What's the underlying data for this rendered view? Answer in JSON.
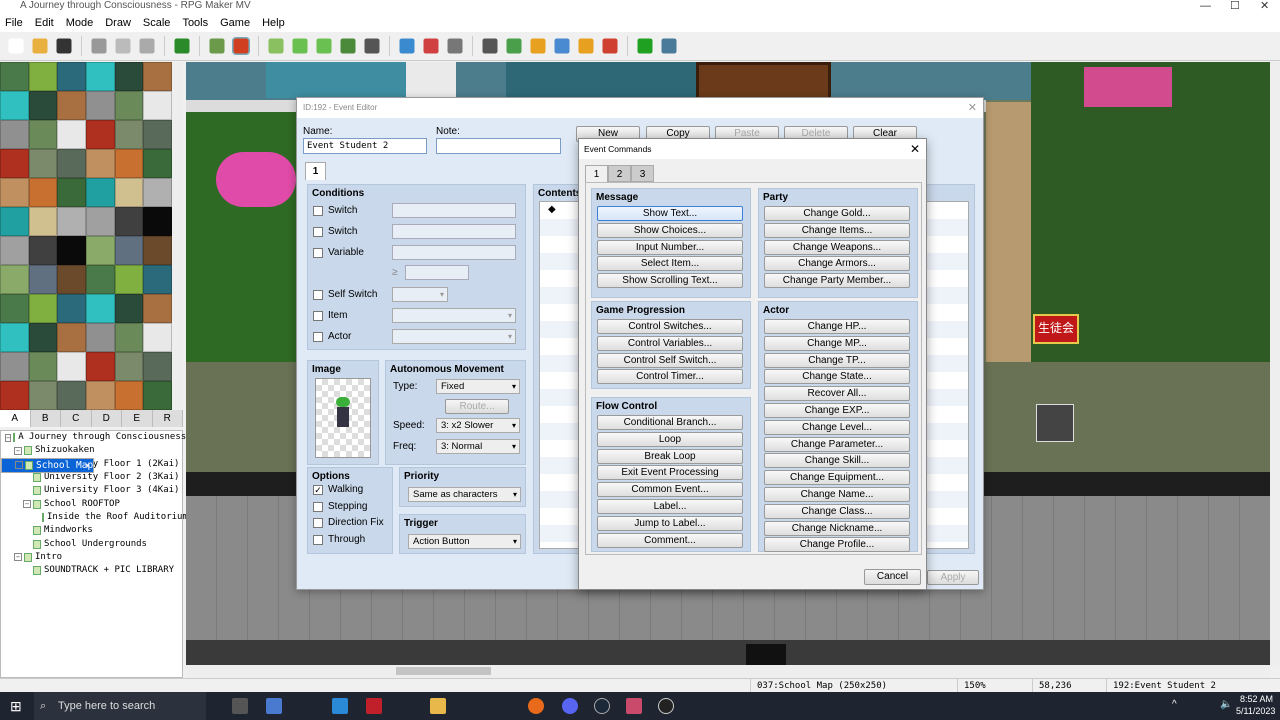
{
  "window": {
    "title": "A Journey through Consciousness - RPG Maker MV"
  },
  "menu": [
    "File",
    "Edit",
    "Mode",
    "Draw",
    "Scale",
    "Tools",
    "Game",
    "Help"
  ],
  "toolbar": [
    "new-icon",
    "open-icon",
    "save-icon",
    "cut-icon",
    "copy-icon",
    "paste-icon",
    "undo-icon",
    "map-mode-icon",
    "event-mode-icon",
    "pencil-icon",
    "rectangle-icon",
    "ellipse-icon",
    "fill-icon",
    "shadow-pen-icon",
    "zoom-in-icon",
    "zoom-out-icon",
    "actual-size-icon",
    "database-icon",
    "plugin-manager-icon",
    "sound-test-icon",
    "event-searcher-icon",
    "resource-manager-icon",
    "character-generator-icon",
    "playtest-icon",
    "deployment-icon"
  ],
  "tileset_tabs": [
    "A",
    "B",
    "C",
    "D",
    "E",
    "R"
  ],
  "map_tree": [
    {
      "label": "A Journey through Consciousness",
      "level": 0,
      "expander": true
    },
    {
      "label": "Shizuokaken",
      "level": 1,
      "expander": true
    },
    {
      "label": "School Map",
      "level": 1,
      "expander": true,
      "selected": true
    },
    {
      "label": "University Floor 1 (2Kai)",
      "level": 2
    },
    {
      "label": "University Floor 2 (3Kai)",
      "level": 2
    },
    {
      "label": "University Floor 3 (4Kai)",
      "level": 2
    },
    {
      "label": "School ROOFTOP",
      "level": 2,
      "expander": true
    },
    {
      "label": "Inside the Roof Auditorium",
      "level": 3
    },
    {
      "label": "Mindworks",
      "level": 2
    },
    {
      "label": "School Undergrounds",
      "level": 2
    },
    {
      "label": "Intro",
      "level": 1,
      "expander": true
    },
    {
      "label": "SOUNDTRACK + PIC LIBRARY",
      "level": 2
    }
  ],
  "event_editor": {
    "title": "ID:192 - Event Editor",
    "name_label": "Name:",
    "name_value": "Event Student 2",
    "note_label": "Note:",
    "note_value": "",
    "buttons": {
      "new": "New",
      "copy": "Copy",
      "paste": "Paste",
      "delete": "Delete",
      "clear": "Clear"
    },
    "page_tab": "1",
    "conditions": {
      "title": "Conditions",
      "items": [
        "Switch",
        "Switch",
        "Variable",
        "Self Switch",
        "Item",
        "Actor"
      ],
      "ge": "≥"
    },
    "image": {
      "title": "Image"
    },
    "autonomous": {
      "title": "Autonomous Movement",
      "type_label": "Type:",
      "type_value": "Fixed",
      "route": "Route...",
      "speed_label": "Speed:",
      "speed_value": "3: x2 Slower",
      "freq_label": "Freq:",
      "freq_value": "3: Normal"
    },
    "options": {
      "title": "Options",
      "items": [
        {
          "label": "Walking",
          "checked": true
        },
        {
          "label": "Stepping",
          "checked": false
        },
        {
          "label": "Direction Fix",
          "checked": false
        },
        {
          "label": "Through",
          "checked": false
        }
      ]
    },
    "priority": {
      "title": "Priority",
      "value": "Same as characters"
    },
    "trigger": {
      "title": "Trigger",
      "value": "Action Button"
    },
    "contents": {
      "title": "Contents",
      "first_line": "◆"
    },
    "apply": "Apply"
  },
  "event_commands": {
    "title": "Event Commands",
    "tabs": [
      "1",
      "2",
      "3"
    ],
    "groups": {
      "message": {
        "title": "Message",
        "items": [
          "Show Text...",
          "Show Choices...",
          "Input Number...",
          "Select Item...",
          "Show Scrolling Text..."
        ]
      },
      "game_progression": {
        "title": "Game Progression",
        "items": [
          "Control Switches...",
          "Control Variables...",
          "Control Self Switch...",
          "Control Timer..."
        ]
      },
      "flow_control": {
        "title": "Flow Control",
        "items": [
          "Conditional Branch...",
          "Loop",
          "Break Loop",
          "Exit Event Processing",
          "Common Event...",
          "Label...",
          "Jump to Label...",
          "Comment..."
        ]
      },
      "party": {
        "title": "Party",
        "items": [
          "Change Gold...",
          "Change Items...",
          "Change Weapons...",
          "Change Armors...",
          "Change Party Member..."
        ]
      },
      "actor": {
        "title": "Actor",
        "items": [
          "Change HP...",
          "Change MP...",
          "Change TP...",
          "Change State...",
          "Recover All...",
          "Change EXP...",
          "Change Level...",
          "Change Parameter...",
          "Change Skill...",
          "Change Equipment...",
          "Change Name...",
          "Change Class...",
          "Change Nickname...",
          "Change Profile..."
        ]
      }
    },
    "cancel": "Cancel"
  },
  "map_sign": "生徒会",
  "status": {
    "map": "037:School Map (250x250)",
    "zoom": "150%",
    "coords": "58,236",
    "event": "192:Event Student 2"
  },
  "taskbar": {
    "search_placeholder": "Type here to search",
    "time": "8:52 AM",
    "date": "5/11/2023"
  }
}
